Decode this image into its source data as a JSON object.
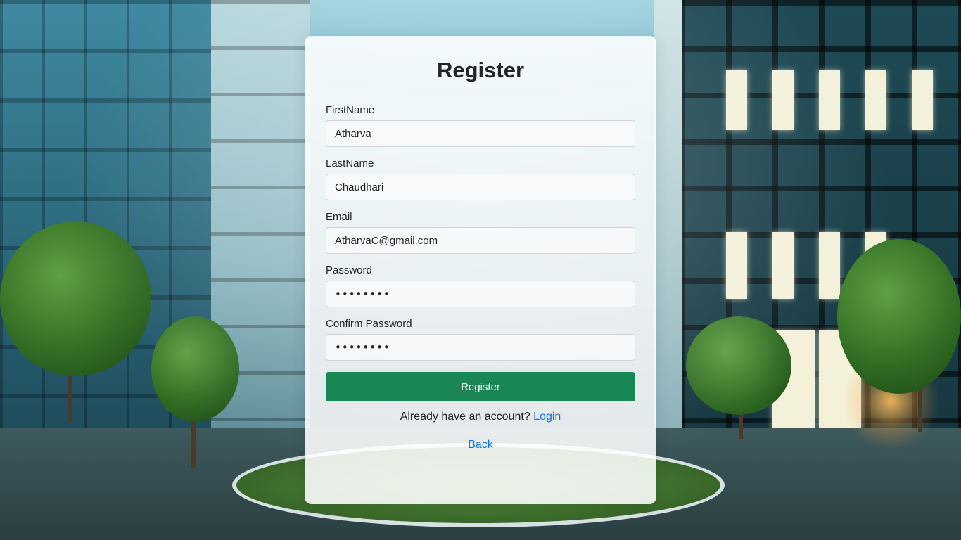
{
  "form": {
    "title": "Register",
    "fields": {
      "first_name": {
        "label": "FirstName",
        "value": "Atharva"
      },
      "last_name": {
        "label": "LastName",
        "value": "Chaudhari"
      },
      "email": {
        "label": "Email",
        "value": "AtharvaC@gmail.com"
      },
      "password": {
        "label": "Password",
        "value": "••••••••"
      },
      "confirm_password": {
        "label": "Confirm Password",
        "value": "••••••••"
      }
    },
    "submit_label": "Register",
    "login_prompt": "Already have an account?",
    "login_link": "Login",
    "back_link": "Back"
  },
  "colors": {
    "accent": "#198754",
    "link": "#0d6efd"
  }
}
